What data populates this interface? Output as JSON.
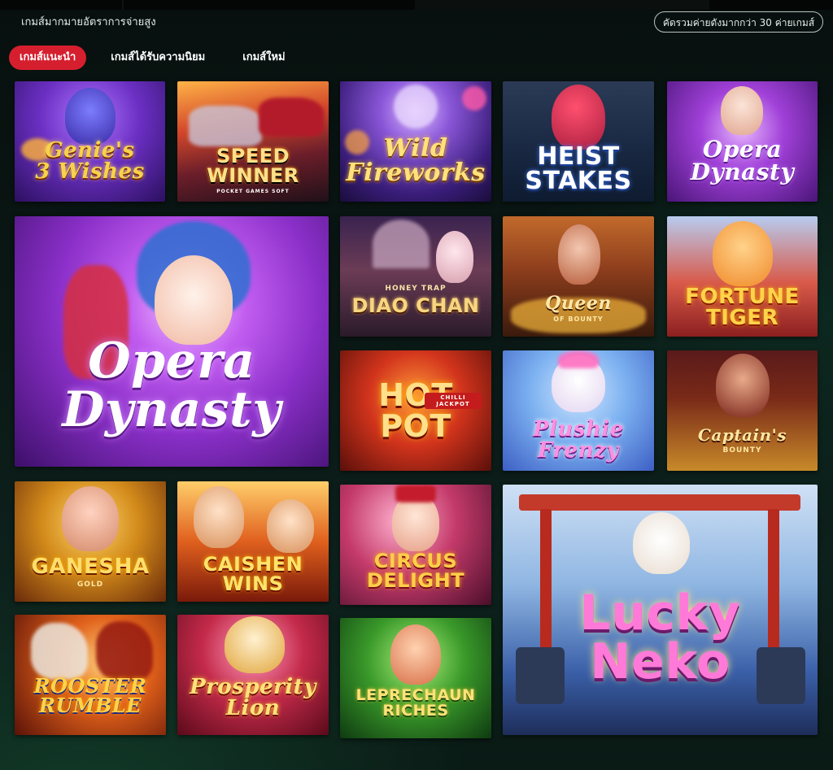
{
  "header": {
    "tagline": "เกมส์มากมายอัตราการจ่ายสูง",
    "providers_button": "คัดรวมค่ายดังมากกว่า 30 ค่ายเกมส์"
  },
  "tabs": [
    {
      "label": "เกมส์แนะนำ",
      "active": true
    },
    {
      "label": "เกมส์ได้รับความนิยม",
      "active": false
    },
    {
      "label": "เกมส์ใหม่",
      "active": false
    }
  ],
  "colors": {
    "accent": "#d61f2e",
    "background": "#0a1714"
  },
  "games": [
    {
      "logo": "Genie's\n3 Wishes",
      "sub": ""
    },
    {
      "logo": "SPEED\nWINNER",
      "sub": "POCKET GAMES SOFT"
    },
    {
      "logo": "Wild\nFireworks",
      "sub": ""
    },
    {
      "logo": "HEIST\nSTAKES",
      "sub": ""
    },
    {
      "logo": "Opera\nDynasty",
      "sub": ""
    },
    {
      "logo": "Opera\nDynasty",
      "sub": ""
    },
    {
      "logo": "DIAO CHAN",
      "sub": "HONEY TRAP"
    },
    {
      "logo": "Queen",
      "sub": "OF BOUNTY"
    },
    {
      "logo": "FORTUNE\nTIGER",
      "sub": ""
    },
    {
      "logo": "HOT\nPOT",
      "sub": "CHILLI JACKPOT"
    },
    {
      "logo": "Plushie\nFrenzy",
      "sub": ""
    },
    {
      "logo": "Captain's",
      "sub": "BOUNTY"
    },
    {
      "logo": "GANESHA",
      "sub": "GOLD"
    },
    {
      "logo": "CAISHEN\nWINS",
      "sub": ""
    },
    {
      "logo": "CIRCUS\nDELIGHT",
      "sub": ""
    },
    {
      "logo": "Lucky\nNeko",
      "sub": ""
    },
    {
      "logo": "ROOSTER\nRUMBLE",
      "sub": ""
    },
    {
      "logo": "Prosperity\nLion",
      "sub": ""
    },
    {
      "logo": "LEPRECHAUN\nRICHES",
      "sub": ""
    }
  ]
}
